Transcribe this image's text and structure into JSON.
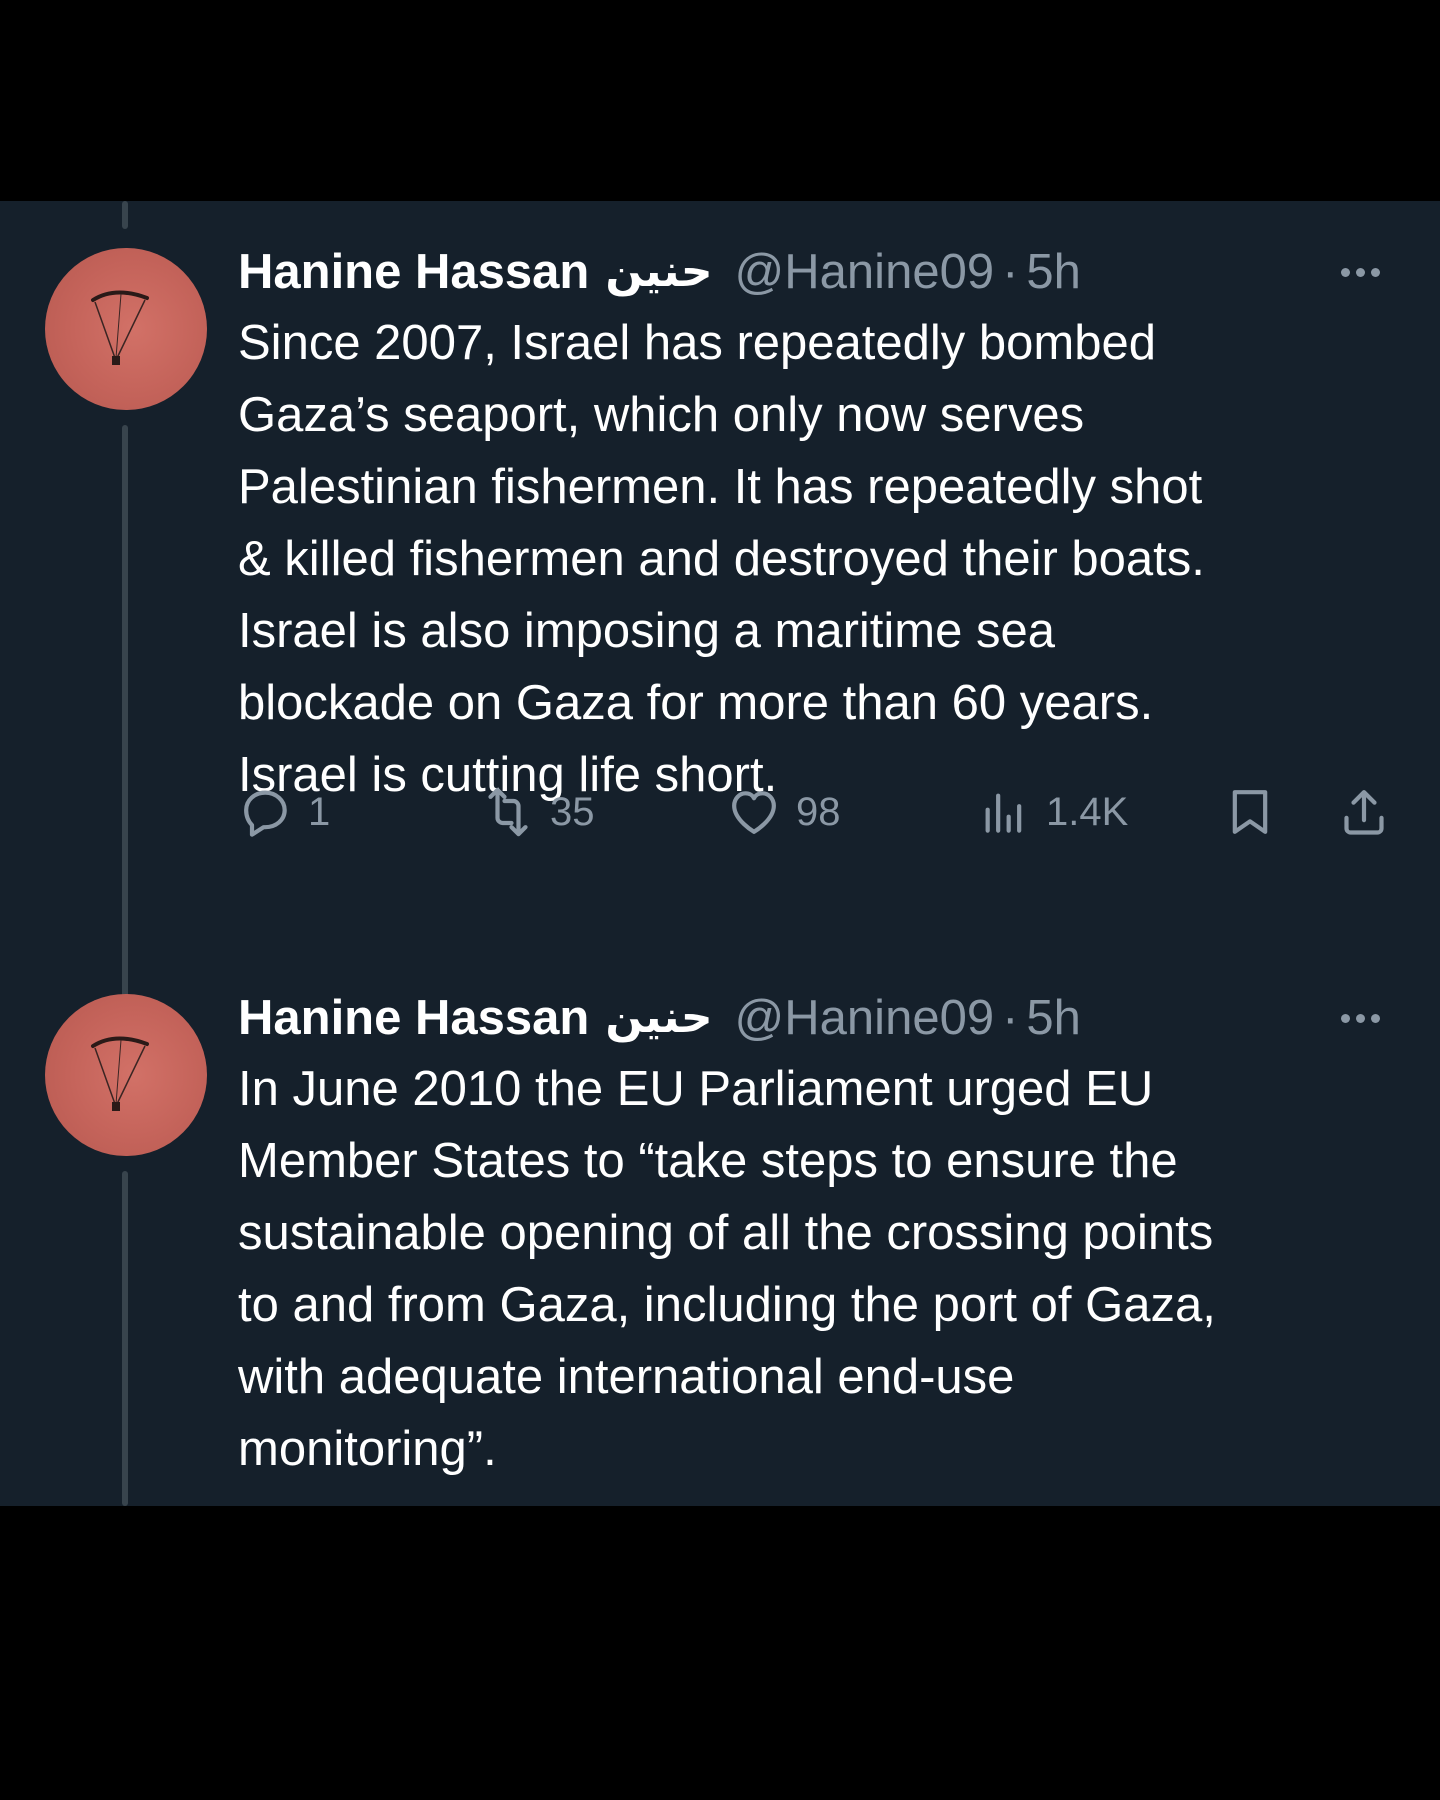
{
  "colors": {
    "page_background": "#000000",
    "panel_background": "#15202b",
    "text_primary": "#ffffff",
    "text_secondary": "#8b98a5",
    "thread_line": "#38444d",
    "avatar": "#c4635a"
  },
  "tweets": [
    {
      "author_name": "Hanine Hassan",
      "author_name_ar": "حنين",
      "handle": "@Hanine09",
      "separator": "·",
      "time": "5h",
      "avatar_icon": "parachute-icon",
      "body_lines": [
        "Since 2007, Israel has repeatedly bombed",
        "Gaza’s seaport, which only now serves",
        "Palestinian fishermen. It has repeatedly shot",
        "& killed fishermen and destroyed their boats.",
        "Israel is also imposing a maritime sea",
        "blockade on Gaza for more than 60 years.",
        "Israel is cutting life short."
      ],
      "actions": {
        "replies": "1",
        "retweets": "35",
        "likes": "98",
        "views": "1.4K"
      }
    },
    {
      "author_name": "Hanine Hassan",
      "author_name_ar": "حنين",
      "handle": "@Hanine09",
      "separator": "·",
      "time": "5h",
      "avatar_icon": "parachute-icon",
      "body_lines": [
        "In June 2010 the EU Parliament urged EU",
        "Member States to “take steps to ensure the",
        "sustainable opening of all the crossing points",
        "to and from Gaza, including the port of Gaza,",
        "with adequate international end-use",
        "monitoring”."
      ]
    }
  ]
}
